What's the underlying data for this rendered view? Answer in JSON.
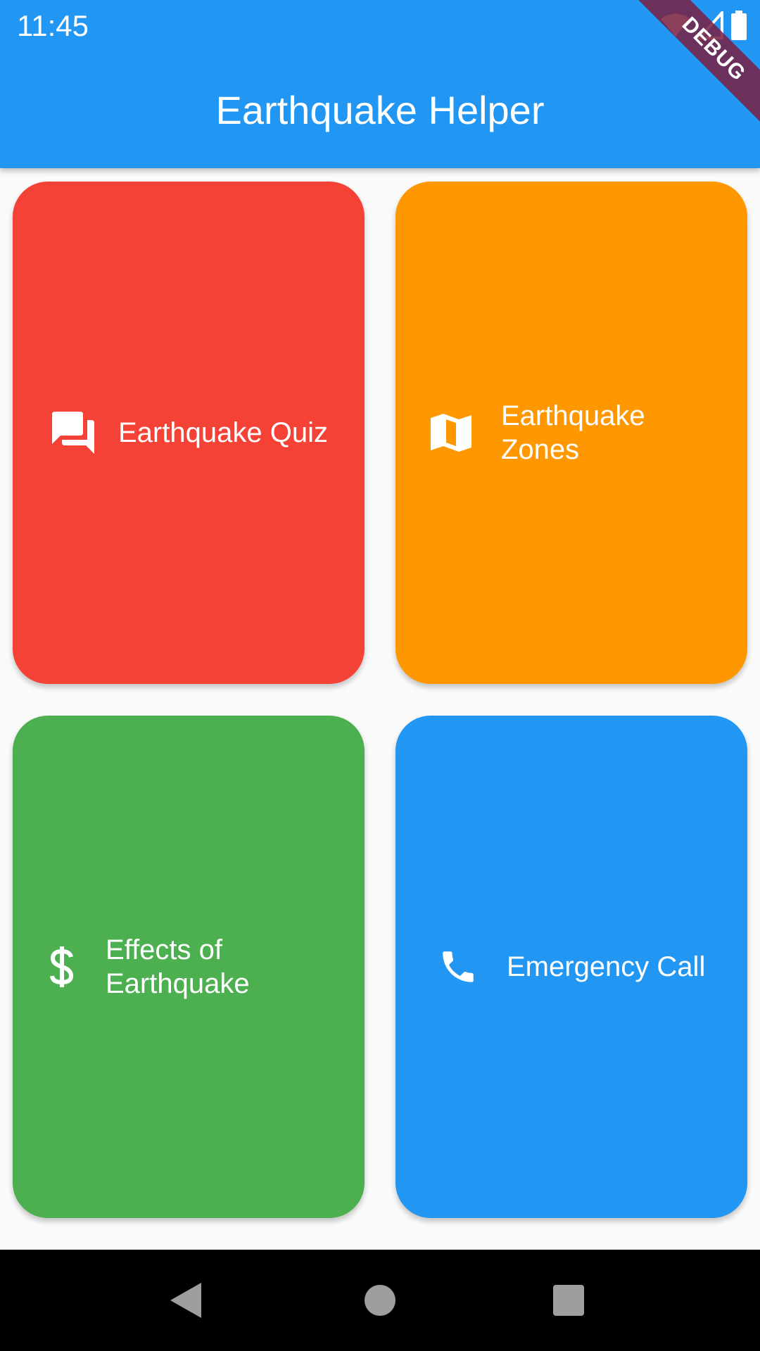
{
  "status_bar": {
    "time": "11:45",
    "icons": [
      "wifi-icon",
      "cell-signal-icon",
      "battery-icon"
    ]
  },
  "app_bar": {
    "title": "Earthquake Helper",
    "debug_banner": "DEBUG"
  },
  "tiles": [
    {
      "label": "Earthquake Quiz",
      "icon": "forum-icon",
      "color": "#F44336"
    },
    {
      "label": "Earthquake Zones",
      "icon": "map-icon",
      "color": "#FF9800"
    },
    {
      "label": "Effects of Earthquake",
      "icon": "dollar-icon",
      "color": "#4CAF50"
    },
    {
      "label": "Emergency Call",
      "icon": "phone-icon",
      "color": "#2196F3"
    }
  ],
  "nav_bar": {
    "buttons": [
      "back-icon",
      "home-icon",
      "recents-icon"
    ]
  },
  "colors": {
    "app_bar": "#2196F3",
    "background": "#FAFAFA"
  }
}
